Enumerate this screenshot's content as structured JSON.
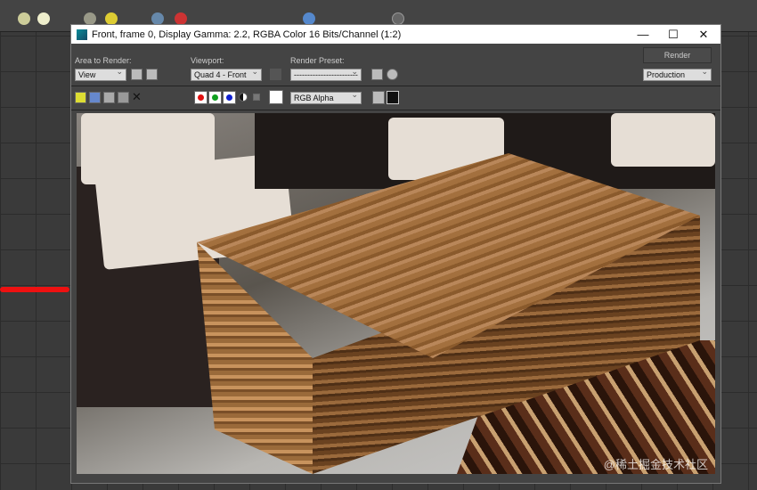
{
  "window": {
    "title": "Front, frame 0, Display Gamma: 2.2, RGBA Color 16 Bits/Channel (1:2)",
    "minimize": "—",
    "maximize": "☐",
    "close": "✕"
  },
  "toolbar": {
    "area_label": "Area to Render:",
    "area_value": "View",
    "viewport_label": "Viewport:",
    "viewport_value": "Quad 4 - Front",
    "preset_label": "Render Preset:",
    "preset_value": "------------------------",
    "render_button": "Render",
    "render_mode": "Production",
    "channel_value": "RGB Alpha"
  },
  "colors": {
    "red": "#e01010",
    "green": "#10a020",
    "blue": "#1020d0"
  },
  "watermark": "@稀土掘金技术社区"
}
